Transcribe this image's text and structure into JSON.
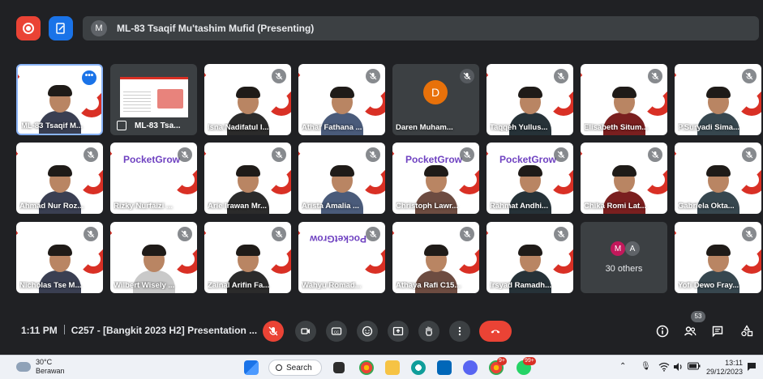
{
  "topbar": {
    "presenting_avatar": "M",
    "presenting_text": "ML-83 Tsaqif Mu'tashim Mufid (Presenting)"
  },
  "tiles": [
    {
      "name": "ML-83 Tsaqif M...",
      "kind": "self"
    },
    {
      "name": "ML-83 Tsa...",
      "kind": "presentation"
    },
    {
      "name": "Isna Nadifatul I...",
      "kind": "person"
    },
    {
      "name": "Athar Fathana ...",
      "kind": "person"
    },
    {
      "name": "Daren Muham...",
      "kind": "avatar",
      "avatar_letter": "D"
    },
    {
      "name": "Taqqeh Yullus...",
      "kind": "person"
    },
    {
      "name": "Elisabeth Situm...",
      "kind": "person"
    },
    {
      "name": "P.Suryadi Sima...",
      "kind": "person"
    },
    {
      "name": "Ahmad Nur Roz...",
      "kind": "person"
    },
    {
      "name": "Rizky Nurfaizi ...",
      "kind": "brand",
      "brand": "PocketGrow"
    },
    {
      "name": "Arie Irawan Mr...",
      "kind": "person"
    },
    {
      "name": "Arista Amalia ...",
      "kind": "person"
    },
    {
      "name": "Christoph Lawr...",
      "kind": "brand",
      "brand": "PocketGrow"
    },
    {
      "name": "Rahmat Andhi...",
      "kind": "brand",
      "brand": "PocketGrow"
    },
    {
      "name": "Chika Romi Lat...",
      "kind": "person"
    },
    {
      "name": "Gabriela Okta...",
      "kind": "person"
    },
    {
      "name": "Nicholas Tse M...",
      "kind": "person"
    },
    {
      "name": "Wilbert Wisely ...",
      "kind": "person"
    },
    {
      "name": "Zainal Arifin Fa...",
      "kind": "person"
    },
    {
      "name": "Wahyu Romad...",
      "kind": "brand-flipped",
      "brand": "PocketGrow"
    },
    {
      "name": "Athaya Rafi C15...",
      "kind": "person"
    },
    {
      "name": "Irsyad Ramadh...",
      "kind": "person"
    },
    {
      "name": "",
      "kind": "others"
    },
    {
      "name": "Yofi Dewo Fray...",
      "kind": "person"
    }
  ],
  "others_tile": {
    "avatars": [
      "M",
      "A"
    ],
    "count_label": "30 others"
  },
  "controls": {
    "time": "1:11 PM",
    "meeting_title": "C257 - [Bangkit 2023 H2] Presentation ...",
    "participants_count": "53"
  },
  "taskbar": {
    "temperature": "30°C",
    "weather": "Berawan",
    "search_label": "Search",
    "clock_time": "13:11",
    "clock_date": "29/12/2023",
    "chrome_badge": "9+",
    "whatsapp_badge": "99+"
  },
  "colors": {
    "background": "#202124",
    "tile_dark": "#3c4043",
    "accent_red": "#ea4335",
    "accent_blue": "#1a73e8",
    "brand_purple": "#6f42c1",
    "avatar_orange": "#e8710a"
  }
}
